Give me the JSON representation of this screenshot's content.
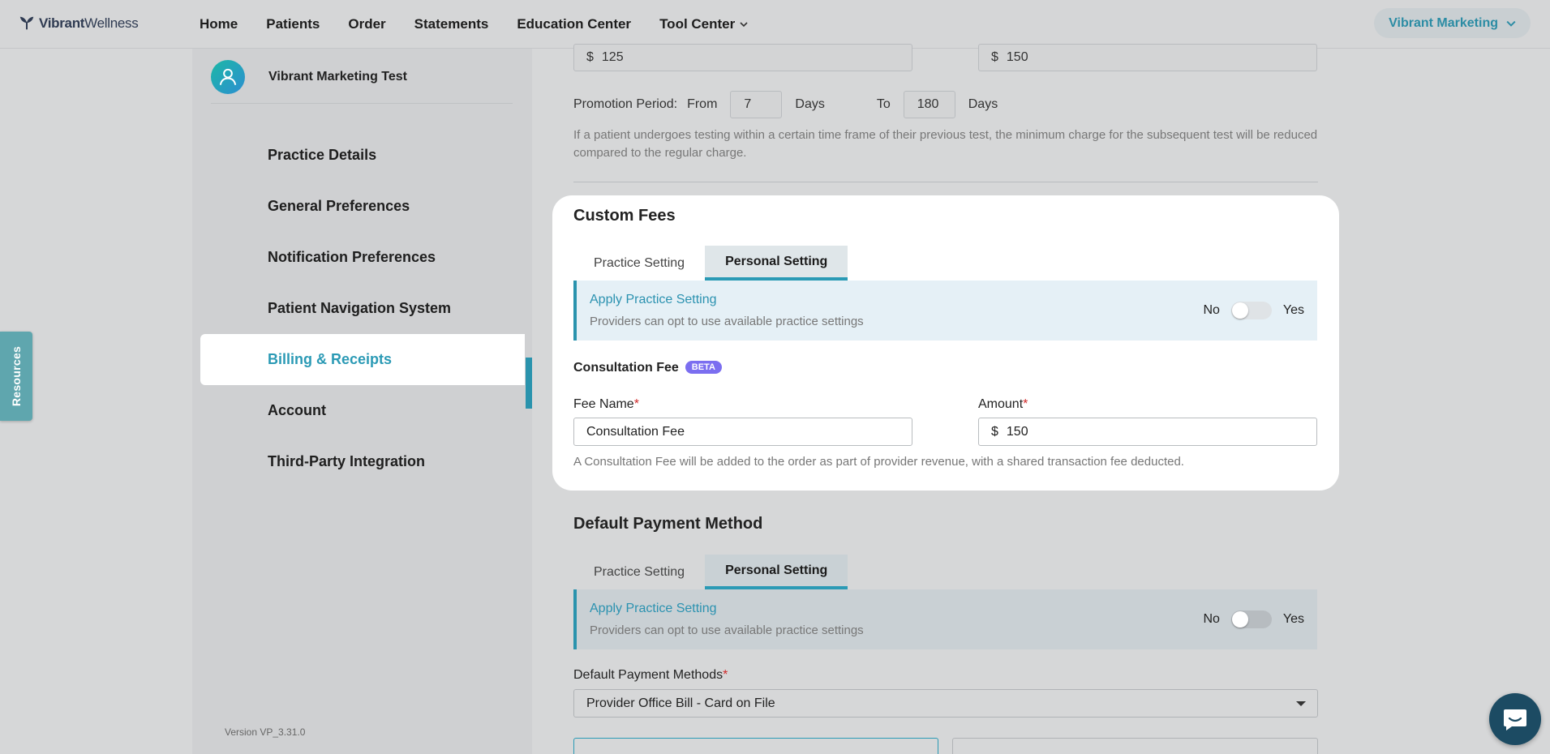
{
  "brand": {
    "logo_bold": "Vibrant",
    "logo_light": "Wellness"
  },
  "nav": {
    "items": [
      "Home",
      "Patients",
      "Order",
      "Statements",
      "Education Center",
      "Tool Center"
    ],
    "account": "Vibrant Marketing"
  },
  "sidebar": {
    "profile_name": "Vibrant Marketing Test",
    "items": [
      "Practice Details",
      "General Preferences",
      "Notification Preferences",
      "Patient Navigation System",
      "Billing & Receipts",
      "Account",
      "Third-Party Integration"
    ],
    "active_index": 4,
    "version": "Version VP_3.31.0"
  },
  "resources_label": "Resources",
  "top_fields": {
    "currency": "$",
    "left_value": "125",
    "right_value": "150"
  },
  "promotion": {
    "label": "Promotion Period:",
    "from_label": "From",
    "from_value": "7",
    "from_unit": "Days",
    "to_label": "To",
    "to_value": "180",
    "to_unit": "Days",
    "note": "If a patient undergoes testing within a certain time frame of their previous test, the minimum charge for the subsequent test will be reduced compared to the regular charge."
  },
  "custom_fees": {
    "title": "Custom Fees",
    "tabs": [
      "Practice Setting",
      "Personal Setting"
    ],
    "active_tab": 1,
    "apply": {
      "title": "Apply Practice Setting",
      "subtitle": "Providers can opt to use available practice settings",
      "no_label": "No",
      "yes_label": "Yes"
    },
    "consultation_label": "Consultation Fee",
    "beta_label": "BETA",
    "fee_name_label": "Fee Name",
    "fee_name_value": "Consultation Fee",
    "amount_label": "Amount",
    "currency": "$",
    "amount_value": "150",
    "note": "A Consultation Fee will be added to the order as part of provider revenue, with a shared transaction fee deducted."
  },
  "payment": {
    "title": "Default Payment Method",
    "tabs": [
      "Practice Setting",
      "Personal Setting"
    ],
    "active_tab": 1,
    "apply": {
      "title": "Apply Practice Setting",
      "subtitle": "Providers can opt to use available practice settings",
      "no_label": "No",
      "yes_label": "Yes"
    },
    "methods_label": "Default Payment Methods",
    "selected_method": "Provider Office Bill - Card on File"
  },
  "colors": {
    "accent": "#2a9ab5",
    "beta": "#7b6ef0",
    "chat": "#1c4b63"
  }
}
